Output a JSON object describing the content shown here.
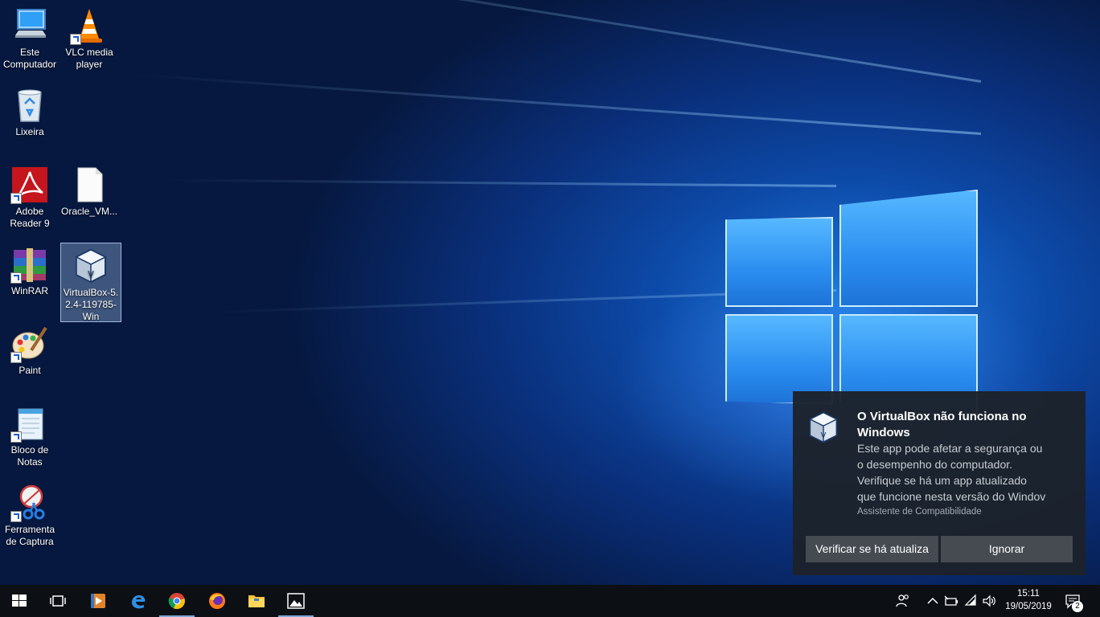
{
  "desktop_icons": [
    {
      "label": "Este Computador",
      "icon": "computer-icon"
    },
    {
      "label": "VLC media player",
      "icon": "vlc-icon"
    },
    {
      "label": "Lixeira",
      "icon": "recycle-bin-icon"
    },
    {
      "label": "Adobe Reader 9",
      "icon": "adobe-reader-icon"
    },
    {
      "label": "Oracle_VM...",
      "icon": "file-icon"
    },
    {
      "label": "WinRAR",
      "icon": "winrar-icon"
    },
    {
      "label": "VirtualBox-5.2.4-119785-Win",
      "icon": "virtualbox-icon"
    },
    {
      "label": "Paint",
      "icon": "paint-icon"
    },
    {
      "label": "Bloco de Notas",
      "icon": "notepad-icon"
    },
    {
      "label": "Ferramenta de Captura",
      "icon": "snipping-tool-icon"
    }
  ],
  "notification": {
    "title": "O VirtualBox não funciona no Windows",
    "body_lines": [
      "Este app pode afetar a segurança ou",
      "o desempenho do computador.",
      "Verifique se há um app atualizado",
      "que funcione nesta versão do Windov"
    ],
    "source": "Assistente de Compatibilidade",
    "primary_button": "Verificar se há atualiza",
    "secondary_button": "Ignorar"
  },
  "taskbar": {
    "pinned": [
      {
        "name": "start-button",
        "icon": "windows-logo-icon"
      },
      {
        "name": "task-view-button",
        "icon": "task-view-icon"
      },
      {
        "name": "media-player-button",
        "icon": "media-player-icon"
      },
      {
        "name": "edge-button",
        "icon": "edge-icon"
      },
      {
        "name": "chrome-button",
        "icon": "chrome-icon"
      },
      {
        "name": "firefox-button",
        "icon": "firefox-icon"
      },
      {
        "name": "file-explorer-button",
        "icon": "folder-icon"
      },
      {
        "name": "photos-button",
        "icon": "photos-icon"
      }
    ],
    "clock": {
      "time": "15:11",
      "date": "19/05/2019"
    },
    "notification_count": "2"
  },
  "colors": {
    "accent": "#0a5fd1",
    "toast_bg": "#1c222b",
    "toast_button": "#464b52",
    "taskbar_bg": "#0c0f14"
  }
}
